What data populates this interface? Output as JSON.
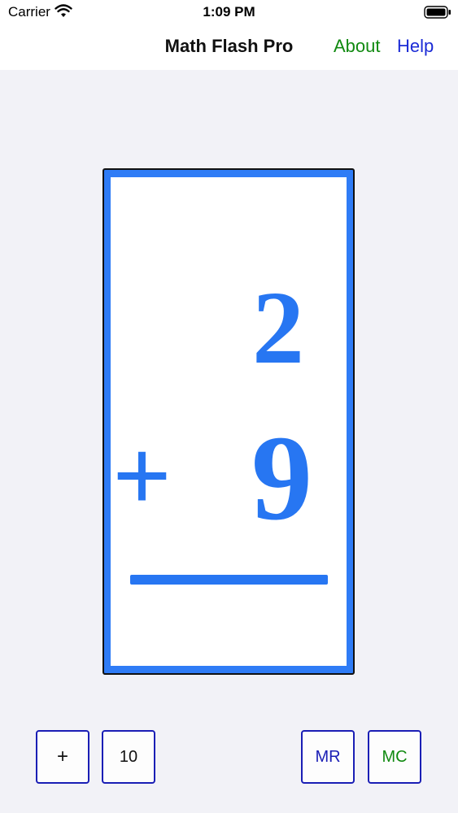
{
  "status_bar": {
    "carrier": "Carrier",
    "time": "1:09 PM",
    "icons": [
      "wifi-icon",
      "battery-icon"
    ]
  },
  "nav": {
    "title": "Math Flash Pro",
    "about": "About",
    "help": "Help",
    "about_color": "#118a11",
    "help_color": "#1b2bd6"
  },
  "card": {
    "top_operand": "2",
    "operator": "+",
    "bottom_operand": "9",
    "border_color": "#2f7cf6",
    "digit_color": "#2776f2"
  },
  "toolbar": {
    "operation_label": "+",
    "range_label": "10",
    "memory_recall_label": "MR",
    "memory_clear_label": "MC",
    "button_border_color": "#1a1eb5"
  }
}
